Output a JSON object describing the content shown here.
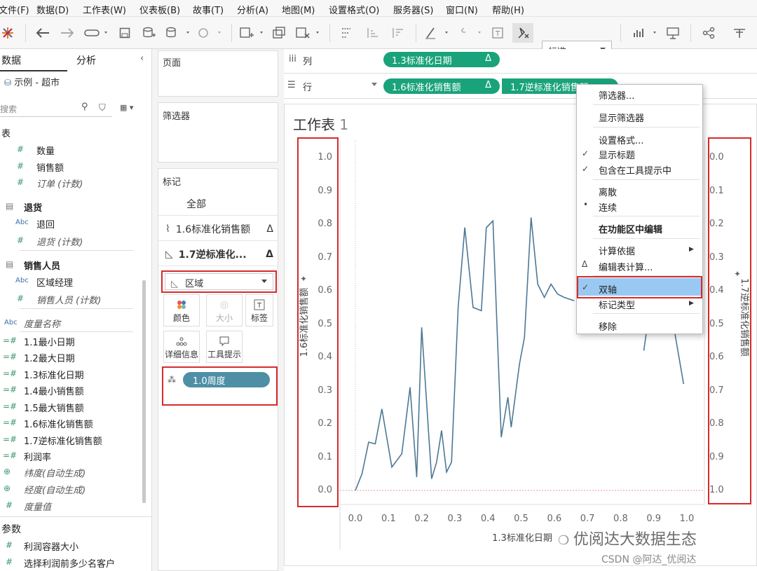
{
  "menu": [
    "文件(F)",
    "数据(D)",
    "工作表(W)",
    "仪表板(B)",
    "故事(T)",
    "分析(A)",
    "地图(M)",
    "设置格式(O)",
    "服务器(S)",
    "窗口(N)",
    "帮助(H)"
  ],
  "toolbar": {
    "view_select": "标准"
  },
  "data_pane": {
    "tabs": [
      "数据",
      "分析"
    ],
    "datasource": "示例 - 超市",
    "search_placeholder": "搜索",
    "fields": [
      {
        "icon": "表",
        "label": ""
      },
      {
        "icon": "#",
        "label": "数量"
      },
      {
        "icon": "#",
        "label": "销售额"
      },
      {
        "icon": "#",
        "label": "订单 (计数)"
      },
      {
        "icon": "table",
        "label": "退货"
      },
      {
        "icon": "Abc",
        "label": "退回"
      },
      {
        "icon": "#",
        "label": "退货 (计数)"
      },
      {
        "icon": "table",
        "label": "销售人员"
      },
      {
        "icon": "Abc",
        "label": "区域经理"
      },
      {
        "icon": "#",
        "label": "销售人员 (计数)"
      },
      {
        "icon": "Abc",
        "label": "度量名称"
      },
      {
        "icon": "=#",
        "label": "1.1最小日期"
      },
      {
        "icon": "=#",
        "label": "1.2最大日期"
      },
      {
        "icon": "=#",
        "label": "1.3标准化日期"
      },
      {
        "icon": "=#",
        "label": "1.4最小销售额"
      },
      {
        "icon": "=#",
        "label": "1.5最大销售额"
      },
      {
        "icon": "=#",
        "label": "1.6标准化销售额"
      },
      {
        "icon": "=#",
        "label": "1.7逆标准化销售额"
      },
      {
        "icon": "=#",
        "label": "利润率"
      },
      {
        "icon": "globe",
        "label": "纬度(自动生成)"
      },
      {
        "icon": "globe",
        "label": "经度(自动生成)"
      },
      {
        "icon": "#",
        "label": "度量值"
      }
    ],
    "params_header": "参数",
    "params": [
      "利润容器大小",
      "选择利润前多少名客户"
    ]
  },
  "shelves": {
    "pages": "页面",
    "filters": "筛选器",
    "marks": "标记",
    "marks_all": "全部",
    "marks_layer1": "1.6标准化销售额",
    "marks_layer2": "1.7逆标准化...",
    "mark_type": "区域",
    "mark_buttons": [
      "颜色",
      "大小",
      "标签",
      "详细信息",
      "工具提示"
    ],
    "detail_pill": "1.0周度",
    "delta": "Δ"
  },
  "columns_shelf": {
    "label": "列",
    "pill": "1.3标准化日期"
  },
  "rows_shelf": {
    "label": "行",
    "pills": [
      "1.6标准化销售额",
      "1.7逆标准化销售额"
    ]
  },
  "worksheet": {
    "title": "工作表",
    "title_num": "1",
    "y_left_label": "1.6标准化销售额",
    "y_right_label": "1.7逆标准化销售额",
    "x_label": "1.3标准化日期"
  },
  "context_menu": {
    "items": [
      "筛选器...",
      "显示筛选器",
      "设置格式...",
      "显示标题",
      "包含在工具提示中",
      "离散",
      "连续",
      "在功能区中编辑",
      "计算依据",
      "编辑表计算...",
      "双轴",
      "标记类型",
      "移除"
    ]
  },
  "watermark": {
    "wechat": "优阅达大数据生态",
    "csdn": "CSDN @阿达_优阅达"
  },
  "colors": {
    "accent": "#1aa37a",
    "line": "#4d7894",
    "highlight": "#99c9f3",
    "annotation": "#d62b2b"
  },
  "chart_data": {
    "type": "line",
    "x": [
      0.0,
      0.02,
      0.04,
      0.06,
      0.08,
      0.11,
      0.14,
      0.165,
      0.185,
      0.2,
      0.23,
      0.245,
      0.26,
      0.275,
      0.29,
      0.31,
      0.33,
      0.355,
      0.38,
      0.395,
      0.415,
      0.44,
      0.46,
      0.47,
      0.495,
      0.51,
      0.53,
      0.55,
      0.57,
      0.59,
      0.61,
      0.63,
      0.66
    ],
    "y": [
      0.0,
      0.05,
      0.145,
      0.14,
      0.245,
      0.07,
      0.11,
      0.31,
      0.04,
      0.49,
      0.035,
      0.085,
      0.18,
      0.055,
      0.085,
      0.55,
      0.79,
      0.55,
      0.54,
      0.79,
      0.81,
      0.16,
      0.28,
      0.19,
      0.38,
      0.46,
      0.82,
      0.62,
      0.58,
      0.62,
      0.59,
      0.58,
      0.57
    ],
    "x_hidden_tail": [
      0.87,
      0.9,
      0.945,
      0.99
    ],
    "y_hidden_tail": [
      0.42,
      0.63,
      0.58,
      0.32
    ],
    "xlabel": "1.3标准化日期",
    "ylabel": "1.6标准化销售额",
    "ylabel_right": "1.7逆标准化销售额",
    "xlim": [
      0.0,
      1.0
    ],
    "ylim": [
      0.0,
      1.0
    ],
    "y_right_reversed": true,
    "x_ticks": [
      "0.0",
      "0.1",
      "0.2",
      "0.3",
      "0.4",
      "0.5",
      "0.6",
      "0.7",
      "0.8",
      "0.9",
      "1.0"
    ],
    "y_ticks_left": [
      "1.0",
      "0.9",
      "0.8",
      "0.7",
      "0.6",
      "0.5",
      "0.4",
      "0.3",
      "0.2",
      "0.1",
      "0.0"
    ],
    "y_ticks_right": [
      "0.0",
      "0.1",
      "0.2",
      "0.3",
      "0.4",
      "0.5",
      "0.6",
      "0.7",
      "0.8",
      "0.9",
      "1.0"
    ]
  }
}
